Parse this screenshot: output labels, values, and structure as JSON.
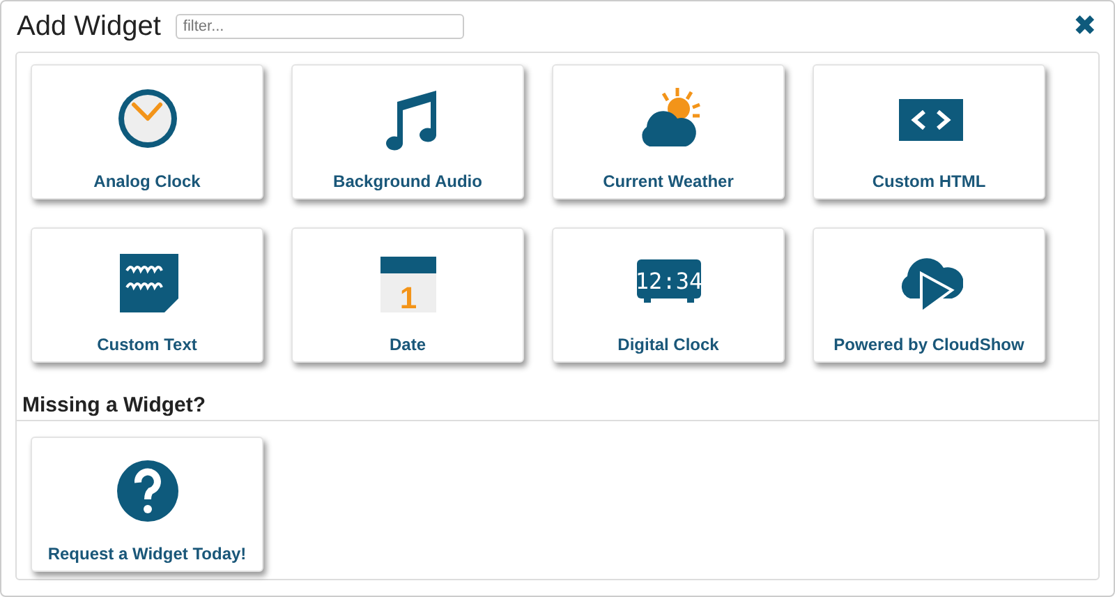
{
  "window": {
    "title": "Add Widget"
  },
  "filter": {
    "placeholder": "filter..."
  },
  "close": {
    "glyph": "✖"
  },
  "widgets": [
    {
      "label": "Analog Clock",
      "kind": "analog-clock"
    },
    {
      "label": "Background Audio",
      "kind": "music"
    },
    {
      "label": "Current Weather",
      "kind": "weather"
    },
    {
      "label": "Custom HTML",
      "kind": "html"
    },
    {
      "label": "Custom Text",
      "kind": "text"
    },
    {
      "label": "Date",
      "kind": "date",
      "icon_text": "1"
    },
    {
      "label": "Digital Clock",
      "kind": "digital-clock",
      "icon_text": "12:34"
    },
    {
      "label": "Powered by CloudShow",
      "kind": "cloud"
    }
  ],
  "missing": {
    "heading": "Missing a Widget?",
    "widgets": [
      {
        "label": "Request a Widget Today!",
        "kind": "question"
      }
    ]
  }
}
